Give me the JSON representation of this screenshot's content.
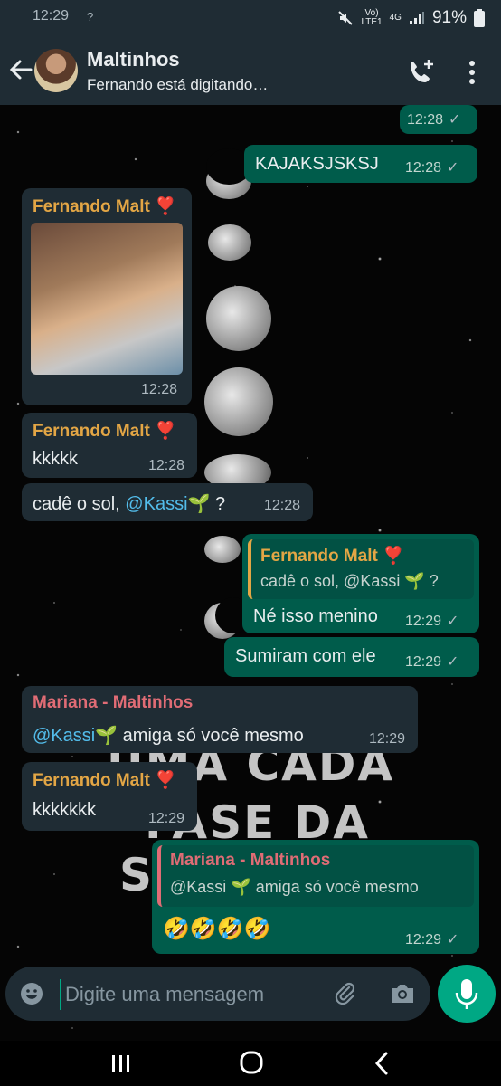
{
  "status": {
    "time": "12:29",
    "net_left": "?",
    "volte": "Vo)",
    "lte": "LTE1",
    "four_g": "4G",
    "battery": "91%"
  },
  "header": {
    "title": "Maltinhos",
    "subtitle": "Fernando está digitando…"
  },
  "messages": {
    "m0": {
      "time": "12:28"
    },
    "m1": {
      "text": "KAJAKSJSKSJ",
      "time": "12:28"
    },
    "m2": {
      "sender": "Fernando Malt ❣️",
      "time": "12:28"
    },
    "m3": {
      "sender": "Fernando Malt ❣️",
      "text": "kkkkk",
      "time": "12:28"
    },
    "m4": {
      "text_prefix": "cadê o sol, ",
      "mention": "@Kassi🌱",
      "text_suffix": " ?",
      "time": "12:28"
    },
    "m5": {
      "quote_sender": "Fernando Malt ❣️",
      "quote_text": "cadê o sol, @Kassi 🌱 ?",
      "text": "Né isso menino",
      "time": "12:29"
    },
    "m6": {
      "text": "Sumiram com ele",
      "time": "12:29"
    },
    "m7": {
      "sender": "Mariana - Maltinhos",
      "mention": "@Kassi🌱",
      "text_suffix": "  amiga só você  mesmo",
      "time": "12:29"
    },
    "m8": {
      "sender": "Fernando Malt ❣️",
      "text": "kkkkkkk",
      "time": "12:29"
    },
    "m9": {
      "quote_sender": "Mariana - Maltinhos",
      "quote_text": "@Kassi 🌱  amiga só você  mesmo",
      "text": "🤣🤣🤣🤣",
      "time": "12:29"
    }
  },
  "background_text": {
    "line1": "UMA CADA",
    "line2": "FASE DA",
    "line3": "S"
  },
  "composer": {
    "placeholder": "Digite uma mensagem"
  },
  "colors": {
    "outgoing": "#005c4b",
    "incoming": "#1f2c34",
    "accent": "#00a884",
    "sender_orange": "#e3a645",
    "sender_pink": "#e06c75",
    "mention": "#53bdeb"
  },
  "icons": [
    "back-arrow-icon",
    "add-call-icon",
    "more-options-icon",
    "emoji-icon",
    "attach-icon",
    "camera-icon",
    "mic-icon",
    "recents-icon",
    "home-icon",
    "nav-back-icon",
    "read-check-icon"
  ]
}
